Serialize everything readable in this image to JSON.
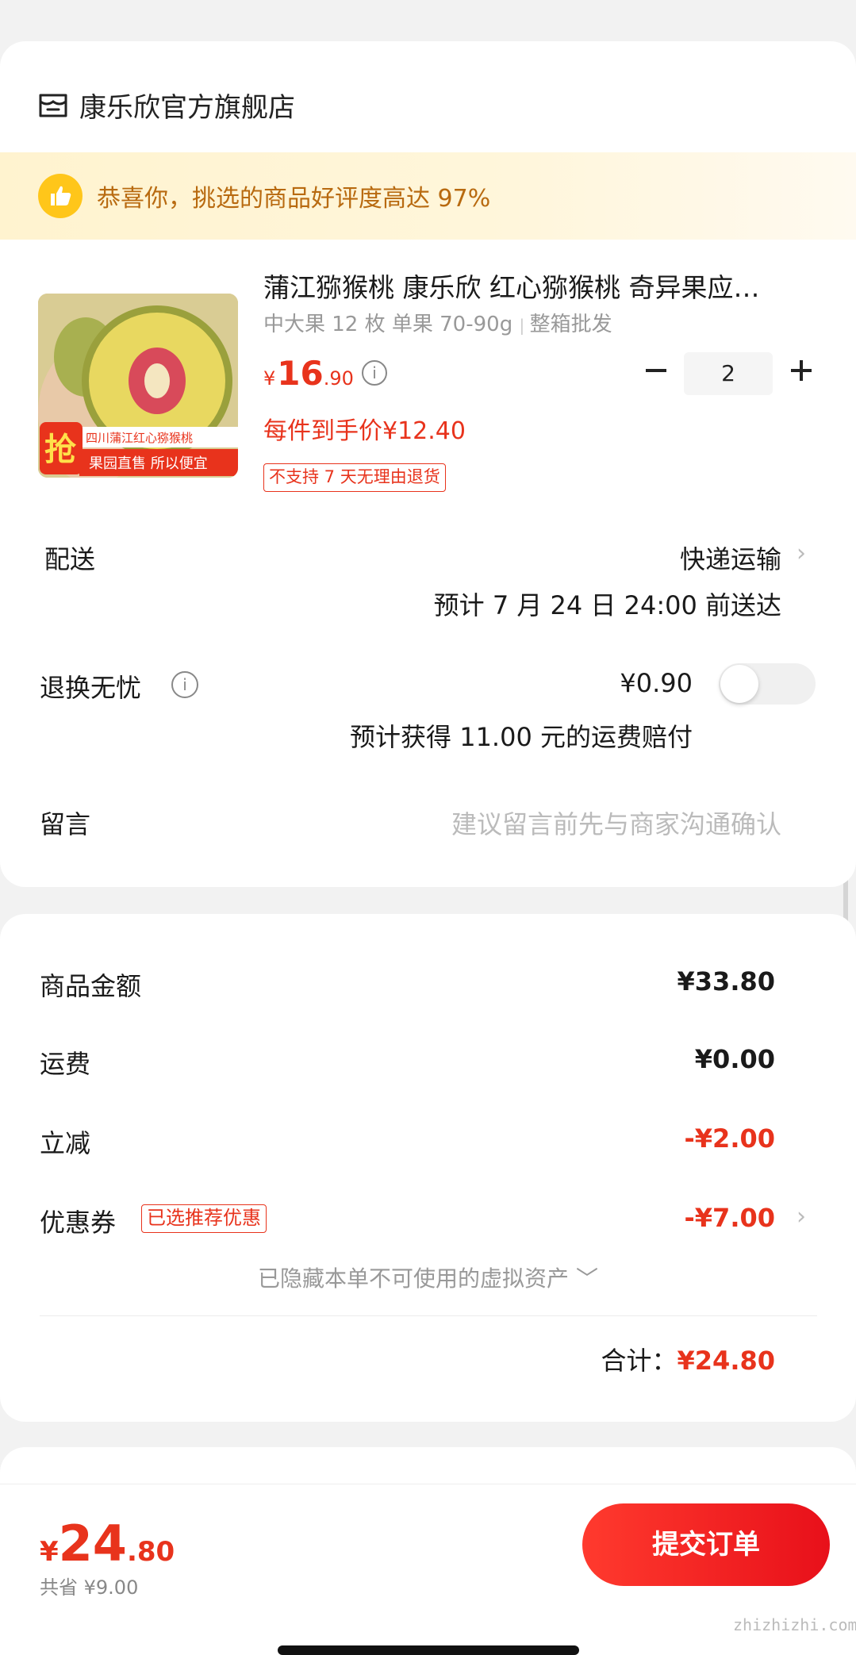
{
  "store": {
    "name": "康乐欣官方旗舰店",
    "icon": "store-icon"
  },
  "praise": {
    "text": "恭喜你，挑选的商品好评度高达 97%",
    "icon": "thumbs-up-icon",
    "color": "#b86a10"
  },
  "product": {
    "title": "蒲江猕猴桃 康乐欣 红心猕猴桃 奇异果应…",
    "spec": "中大果 12 枚 单果 70-90g",
    "spec_extra": "整箱批发",
    "price_symbol": "¥",
    "price_int": "16",
    "price_dec": ".90",
    "per_item_price": "每件到手价¥12.40",
    "no_return_tag": "不支持 7 天无理由退货",
    "image_badge_top": "四川蒲江红心猕猴桃",
    "image_badge_grab": "抢",
    "image_badge_bottom": "果园直售 所以便宜",
    "quantity": "2"
  },
  "delivery": {
    "label": "配送",
    "method": "快递运输",
    "eta": "预计 7 月 24 日 24:00 前送达"
  },
  "return_worry_free": {
    "label": "退换无忧",
    "price": "¥0.90",
    "note": "预计获得 11.00 元的运费赔付",
    "enabled": false
  },
  "message": {
    "label": "留言",
    "placeholder": "建议留言前先与商家沟通确认"
  },
  "summary": {
    "goods_label": "商品金额",
    "goods_value": "¥33.80",
    "shipping_label": "运费",
    "shipping_value": "¥0.00",
    "discount_label": "立减",
    "discount_value": "-¥2.00",
    "coupon_label": "优惠券",
    "coupon_tag": "已选推荐优惠",
    "coupon_value": "-¥7.00",
    "hidden_assets": "已隐藏本单不可使用的虚拟资产 ﹀",
    "total_label": "合计：",
    "total_value": "¥24.80"
  },
  "bottom": {
    "price_symbol": "¥",
    "price_int": "24",
    "price_dec": ".80",
    "saved": "共省 ¥9.00",
    "submit": "提交订单"
  },
  "watermark": "zhizhizhi.com",
  "colors": {
    "accent": "#e8331c",
    "praise_bg": "#fff3cf",
    "badge_yellow": "#ffc61a"
  }
}
